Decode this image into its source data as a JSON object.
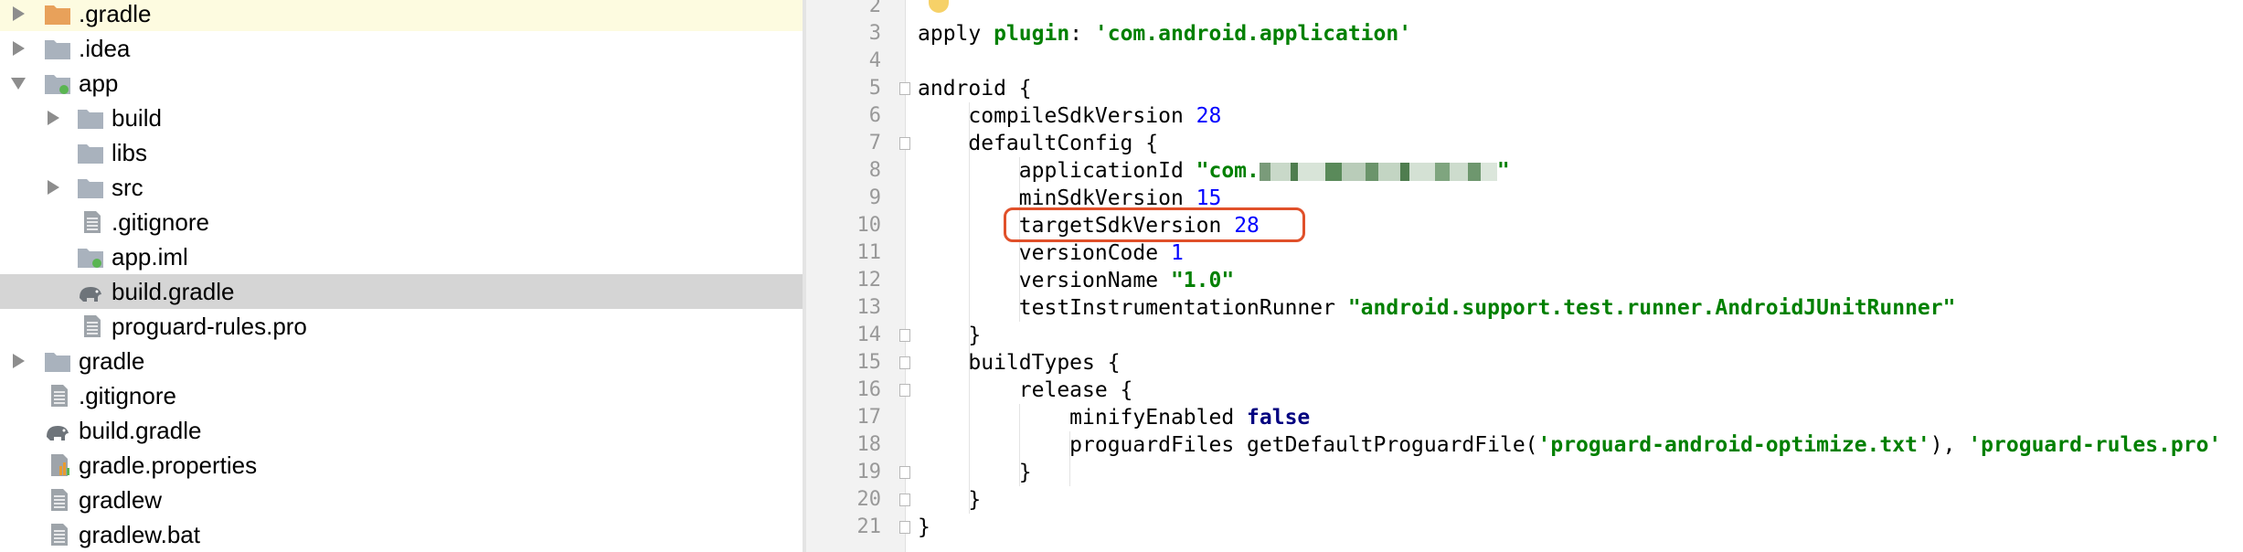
{
  "project_tree": {
    "items": [
      {
        "label": ".gradle",
        "icon": "folder-orange-icon",
        "expand": "right"
      },
      {
        "label": ".idea",
        "icon": "folder-icon",
        "expand": "right"
      },
      {
        "label": "app",
        "icon": "module-folder-icon",
        "expand": "down"
      },
      {
        "label": "build",
        "icon": "folder-icon",
        "expand": "right"
      },
      {
        "label": "libs",
        "icon": "folder-icon",
        "expand": "none"
      },
      {
        "label": "src",
        "icon": "folder-icon",
        "expand": "right"
      },
      {
        "label": ".gitignore",
        "icon": "text-file-icon",
        "expand": "none"
      },
      {
        "label": "app.iml",
        "icon": "module-file-icon",
        "expand": "none"
      },
      {
        "label": "build.gradle",
        "icon": "gradle-elephant-icon",
        "expand": "none",
        "selected": true
      },
      {
        "label": "proguard-rules.pro",
        "icon": "text-file-icon",
        "expand": "none"
      },
      {
        "label": "gradle",
        "icon": "folder-icon",
        "expand": "right"
      },
      {
        "label": ".gitignore",
        "icon": "text-file-icon",
        "expand": "none"
      },
      {
        "label": "build.gradle",
        "icon": "gradle-elephant-icon",
        "expand": "none"
      },
      {
        "label": "gradle.properties",
        "icon": "properties-file-icon",
        "expand": "none"
      },
      {
        "label": "gradlew",
        "icon": "text-file-icon",
        "expand": "none"
      },
      {
        "label": "gradlew.bat",
        "icon": "text-file-icon",
        "expand": "none"
      }
    ]
  },
  "editor": {
    "line_numbers": [
      "2",
      "3",
      "4",
      "5",
      "6",
      "7",
      "8",
      "9",
      "10",
      "11",
      "12",
      "13",
      "14",
      "15",
      "16",
      "17",
      "18",
      "19",
      "20",
      "21"
    ],
    "lines": {
      "l3_a": "apply ",
      "l3_b": "plugin",
      "l3_c": ": ",
      "l3_d": "'com.android.application'",
      "l5": "android {",
      "l6_a": "    compileSdkVersion ",
      "l6_b": "28",
      "l7": "    defaultConfig {",
      "l8_a": "        applicationId ",
      "l8_b": "\"com.",
      "l8_c": "\"",
      "l9_a": "        minSdkVersion ",
      "l9_b": "15",
      "l10_a": "        targetSdkVersion ",
      "l10_b": "28",
      "l11_a": "        versionCode ",
      "l11_b": "1",
      "l12_a": "        versionName ",
      "l12_b": "\"1.0\"",
      "l13_a": "        testInstrumentationRunner ",
      "l13_b": "\"android.support.test.runner.AndroidJUnitRunner\"",
      "l14": "    }",
      "l15": "    buildTypes {",
      "l16": "        release {",
      "l17_a": "            minifyEnabled ",
      "l17_b": "false",
      "l18_a": "            proguardFiles getDefaultProguardFile(",
      "l18_b": "'proguard-android-optimize.txt'",
      "l18_c": "), ",
      "l18_d": "'proguard-rules.pro'",
      "l19": "        }",
      "l20": "    }",
      "l21": "}"
    },
    "highlight_color": "#e0502a"
  }
}
